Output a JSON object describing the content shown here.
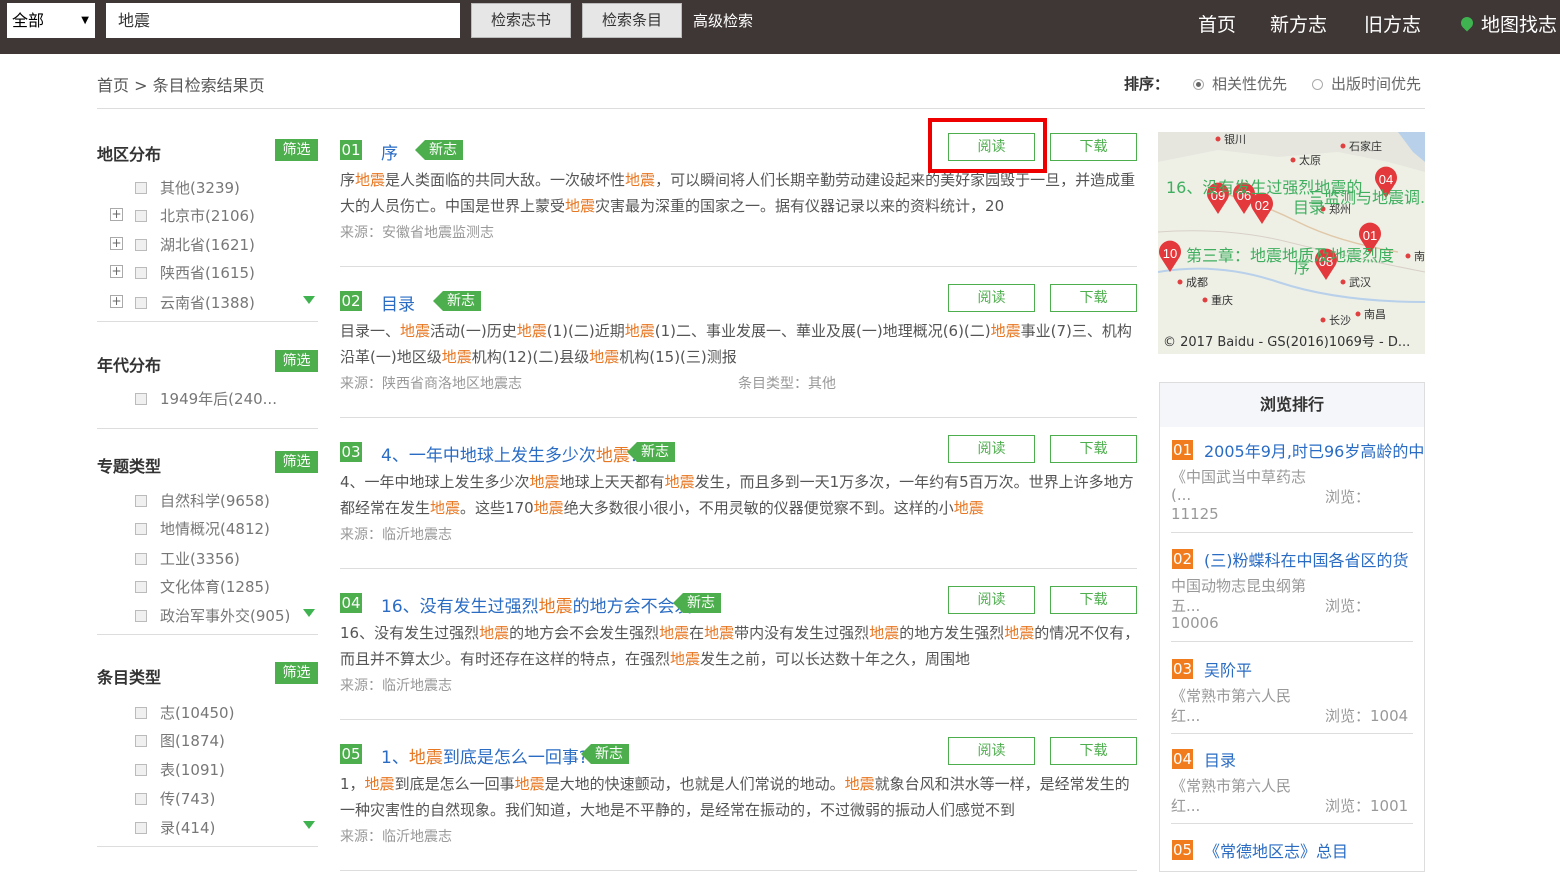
{
  "header": {
    "scope": "全部",
    "search_value": "地震",
    "search_books": "检索志书",
    "search_items": "检索条目",
    "advanced": "高级检索",
    "nav": [
      "首页",
      "新方志",
      "旧方志",
      "地图找志"
    ]
  },
  "breadcrumb": "首页 > 条目检索结果页",
  "sort": {
    "label": "排序：",
    "options": [
      "相关性优先",
      "出版时间优先"
    ],
    "selected": "相关性优先"
  },
  "filters": {
    "filter_button": "筛选",
    "region": {
      "title": "地区分布",
      "items": [
        "其他(3239)",
        "北京市(2106)",
        "湖北省(1621)",
        "陕西省(1615)",
        "云南省(1388)"
      ]
    },
    "era": {
      "title": "年代分布",
      "items": [
        "1949年后(240..."
      ]
    },
    "topic": {
      "title": "专题类型",
      "items": [
        "自然科学(9658)",
        "地情概况(4812)",
        "工业(3356)",
        "文化体育(1285)",
        "政治军事外交(905)"
      ]
    },
    "entry_type": {
      "title": "条目类型",
      "items": [
        "志(10450)",
        "图(1874)",
        "表(1091)",
        "传(743)",
        "录(414)"
      ]
    }
  },
  "results": [
    {
      "num": "01",
      "title": [
        "序"
      ],
      "tag": "新志",
      "body": [
        [
          "",
          "序"
        ],
        [
          "hl",
          "地震"
        ],
        [
          "",
          "是人类面临的共同大敌。一次破坏性"
        ],
        [
          "hl",
          "地震"
        ],
        [
          "",
          "，可以瞬间将人们长期辛勤劳动建设起来的美好家园毁于一旦，并造成重大的人员伤亡。中国是世界上蒙受"
        ],
        [
          "hl",
          "地震"
        ],
        [
          "",
          "灾害最为深重的国家之一。据有仪器记录以来的资料统计，20"
        ]
      ],
      "source": "来源：安徽省地震监测志",
      "type": ""
    },
    {
      "num": "02",
      "title": [
        "目录"
      ],
      "tag": "新志",
      "body": [
        [
          "",
          "目录一、"
        ],
        [
          "hl",
          "地震"
        ],
        [
          "",
          "活动(一)历史"
        ],
        [
          "hl",
          "地震"
        ],
        [
          "",
          "(1)(二)近期"
        ],
        [
          "hl",
          "地震"
        ],
        [
          "",
          "(1)二、事业发展一、華业及展(一)地理概况(6)(二)"
        ],
        [
          "hl",
          "地震"
        ],
        [
          "",
          "事业(7)三、机构沿革(一)地区级"
        ],
        [
          "hl",
          "地震"
        ],
        [
          "",
          "机构(12)(二)县级"
        ],
        [
          "hl",
          "地震"
        ],
        [
          "",
          "机构(15)(三)测报"
        ]
      ],
      "source": "来源：陕西省商洛地区地震志",
      "type": "条目类型：其他"
    },
    {
      "num": "03",
      "title": [
        "4、一年中地球上发生多少次",
        "地震",
        "？"
      ],
      "tag": "新志",
      "body": [
        [
          "",
          "4、一年中地球上发生多少次"
        ],
        [
          "hl",
          "地震"
        ],
        [
          "",
          "地球上天天都有"
        ],
        [
          "hl",
          "地震"
        ],
        [
          "",
          "发生，而且多到一天1万多次，一年约有5百万次。世界上许多地方都经常在发生"
        ],
        [
          "hl",
          "地震"
        ],
        [
          "",
          "。这些170"
        ],
        [
          "hl",
          "地震"
        ],
        [
          "",
          "绝大多数很小很小，不用灵敏的仪器便觉察不到。这样的小"
        ],
        [
          "hl",
          "地震"
        ]
      ],
      "source": "来源：临沂地震志",
      "type": ""
    },
    {
      "num": "04",
      "title": [
        "16、没有发生过强烈",
        "地震",
        "的地方会不会发"
      ],
      "tag": "新志",
      "body": [
        [
          "",
          "16、没有发生过强烈"
        ],
        [
          "hl",
          "地震"
        ],
        [
          "",
          "的地方会不会发生强烈"
        ],
        [
          "hl",
          "地震"
        ],
        [
          "",
          "在"
        ],
        [
          "hl",
          "地震"
        ],
        [
          "",
          "带内没有发生过强烈"
        ],
        [
          "hl",
          "地震"
        ],
        [
          "",
          "的地方发生强烈"
        ],
        [
          "hl",
          "地震"
        ],
        [
          "",
          "的情况不仅有，而且并不算太少。有时还存在这样的特点，在强烈"
        ],
        [
          "hl",
          "地震"
        ],
        [
          "",
          "发生之前，可以长达数十年之久，周围地"
        ]
      ],
      "source": "来源：临沂地震志",
      "type": ""
    },
    {
      "num": "05",
      "title": [
        "1、",
        "地震",
        "到底是怎么一回事?"
      ],
      "tag": "新志",
      "body": [
        [
          "",
          "1，"
        ],
        [
          "hl",
          "地震"
        ],
        [
          "",
          "到底是怎么一回事"
        ],
        [
          "hl",
          "地震"
        ],
        [
          "",
          "是大地的快速颤动，也就是人们常说的地动。"
        ],
        [
          "hl",
          "地震"
        ],
        [
          "",
          "就象台风和洪水等一样，是经常发生的一种灾害性的自然现象。我们知道，大地是不平静的，是经常在振动的，不过微弱的振动人们感觉不到"
        ]
      ],
      "source": "来源：临沂地震志",
      "type": ""
    }
  ],
  "buttons": {
    "read": "阅读",
    "download": "下载"
  },
  "map": {
    "cities": [
      "银川",
      "石家庄",
      "太原",
      "郑州",
      "成都",
      "重庆",
      "武汉",
      "长沙",
      "南昌",
      "南"
    ],
    "labels": [
      "16、没有发生过强烈地震的",
      "目录",
      "三监测与地震调...",
      "第三章：地震地质及地震烈度",
      "序"
    ],
    "markers": [
      "09",
      "06",
      "02",
      "01",
      "10",
      "08",
      "04"
    ],
    "copyright": "© 2017 Baidu - GS(2016)1069号 - D..."
  },
  "ranking": {
    "title": "浏览排行",
    "items": [
      {
        "num": "01",
        "title": "2005年9月,时已96岁高龄的中",
        "sub1": "《中国武当中草药志",
        "sub2": "(...",
        "view": "浏览：",
        "count": "11125"
      },
      {
        "num": "02",
        "title": "(三)粉蝶科在中国各省区的货",
        "sub1": "中国动物志昆虫纲第",
        "sub2": "五...",
        "view": "浏览：",
        "count": "10006"
      },
      {
        "num": "03",
        "title": "吴阶平",
        "sub1": "《常熟市第六人民",
        "sub2": "红...",
        "view": "浏览：1004",
        "count": ""
      },
      {
        "num": "04",
        "title": "目录",
        "sub1": "《常熟市第六人民",
        "sub2": "红...",
        "view": "浏览：1001",
        "count": ""
      },
      {
        "num": "05",
        "title": "《常德地区志》总目",
        "sub1": "",
        "sub2": "",
        "view": "",
        "count": ""
      }
    ]
  },
  "colors": {
    "header_bg": "#3e3735",
    "green": "#4cae4c",
    "link": "#2a6cc4",
    "highlight": "#e87722",
    "rank_orange": "#f07c1d"
  }
}
